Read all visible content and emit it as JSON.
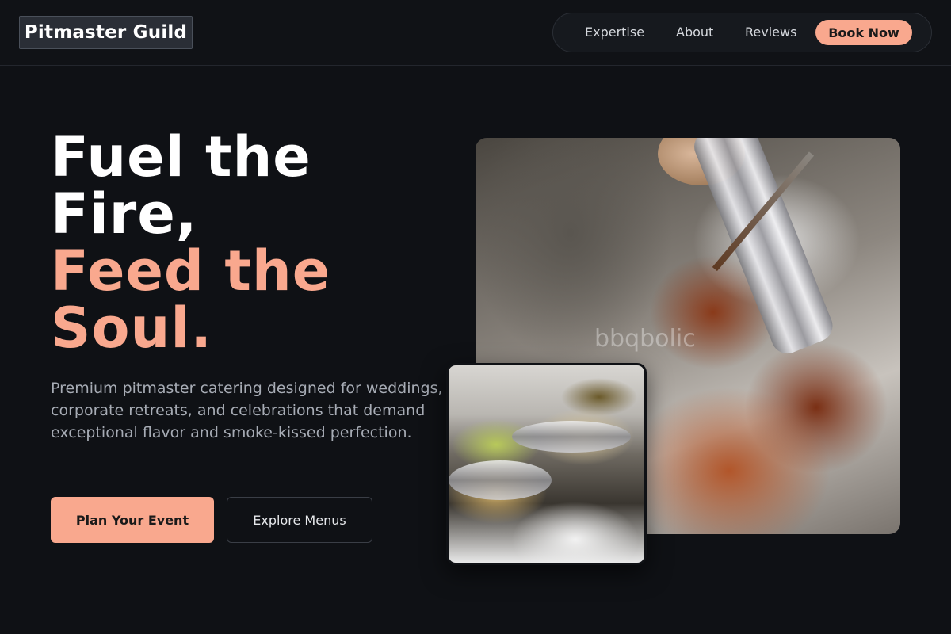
{
  "brand": {
    "name": "Pitmaster Guild"
  },
  "nav": {
    "links": [
      "Expertise",
      "About",
      "Reviews"
    ],
    "cta": "Book Now"
  },
  "hero": {
    "headline_line1": "Fuel the",
    "headline_line2": "Fire,",
    "headline_line3": "Feed the",
    "headline_line4": "Soul.",
    "description": "Premium pitmaster catering designed for weddings, corporate retreats, and celebrations that demand exceptional flavor and smoke-kissed perfection.",
    "primary_button": "Plan Your Event",
    "secondary_button": "Explore Menus"
  },
  "images": {
    "main_watermark": "bbqbolic"
  },
  "colors": {
    "accent": "#f9a88e",
    "background": "#0f1115",
    "muted_text": "#a7acb5"
  }
}
